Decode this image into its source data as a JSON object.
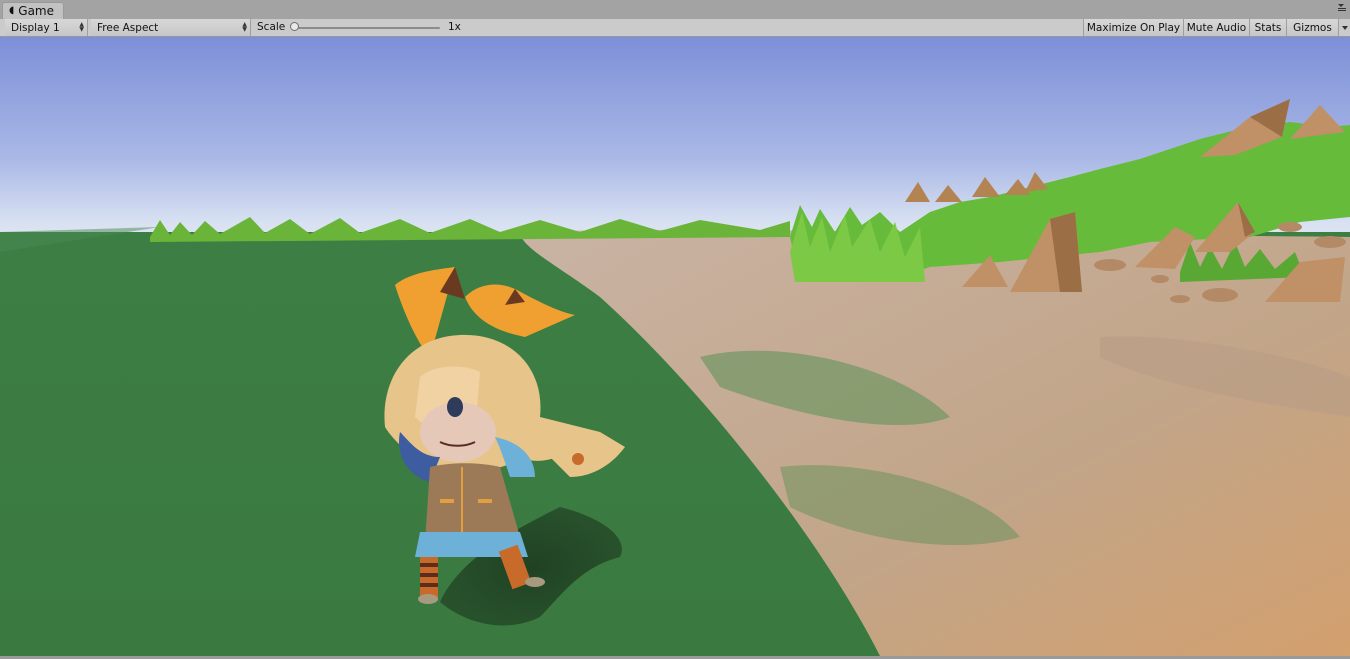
{
  "window": {
    "tab_title": "Game",
    "tab_icon": "game-controller-icon"
  },
  "toolbar": {
    "display_label": "Display 1",
    "aspect_label": "Free Aspect",
    "scale_label": "Scale",
    "scale_value": "1x",
    "scale_slider_position": 0,
    "maximize_label": "Maximize On Play",
    "mute_label": "Mute Audio",
    "stats_label": "Stats",
    "gizmos_label": "Gizmos"
  },
  "colors": {
    "sky_top": "#7d8fd8",
    "sky_horizon": "#dfe6f4",
    "grass": "#3e7f43",
    "sand": "#c9a98a",
    "rock": "#b5845a",
    "tall_grass": "#6cc23c",
    "character_hair": "#e7c48a",
    "character_ears": "#f0a030"
  }
}
